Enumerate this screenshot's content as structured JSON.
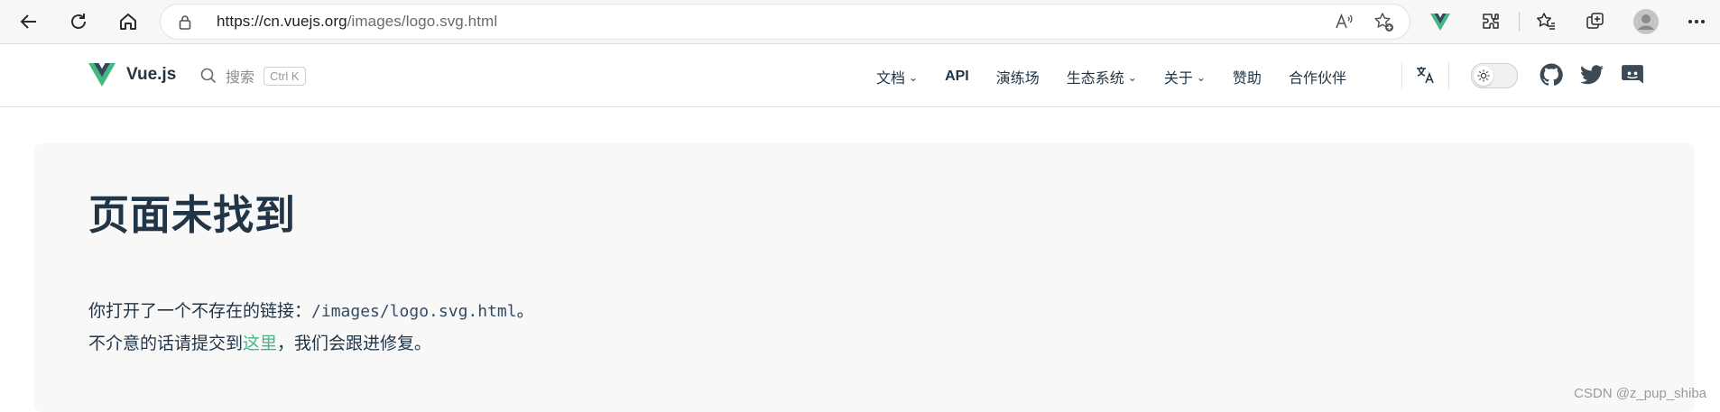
{
  "browser": {
    "url_host": "https://cn.vuejs.org",
    "url_path": "/images/logo.svg.html"
  },
  "site": {
    "brand": "Vue.js",
    "search_label": "搜索",
    "search_shortcut": "Ctrl K",
    "nav": {
      "docs": "文档",
      "api": "API",
      "playground": "演练场",
      "ecosystem": "生态系统",
      "about": "关于",
      "sponsor": "赞助",
      "partners": "合作伙伴"
    }
  },
  "content": {
    "title": "页面未找到",
    "line1_prefix": "你打开了一个不存在的链接：",
    "line1_path": "/images/logo.svg.html",
    "line1_suffix": "。",
    "line2_prefix": "不介意的话请提交到",
    "line2_link": "这里",
    "line2_suffix": "，我们会跟进修复。"
  },
  "watermark": "CSDN @z_pup_shiba",
  "colors": {
    "brand_green": "#42b883",
    "brand_dark": "#35495e",
    "text": "#213547"
  }
}
